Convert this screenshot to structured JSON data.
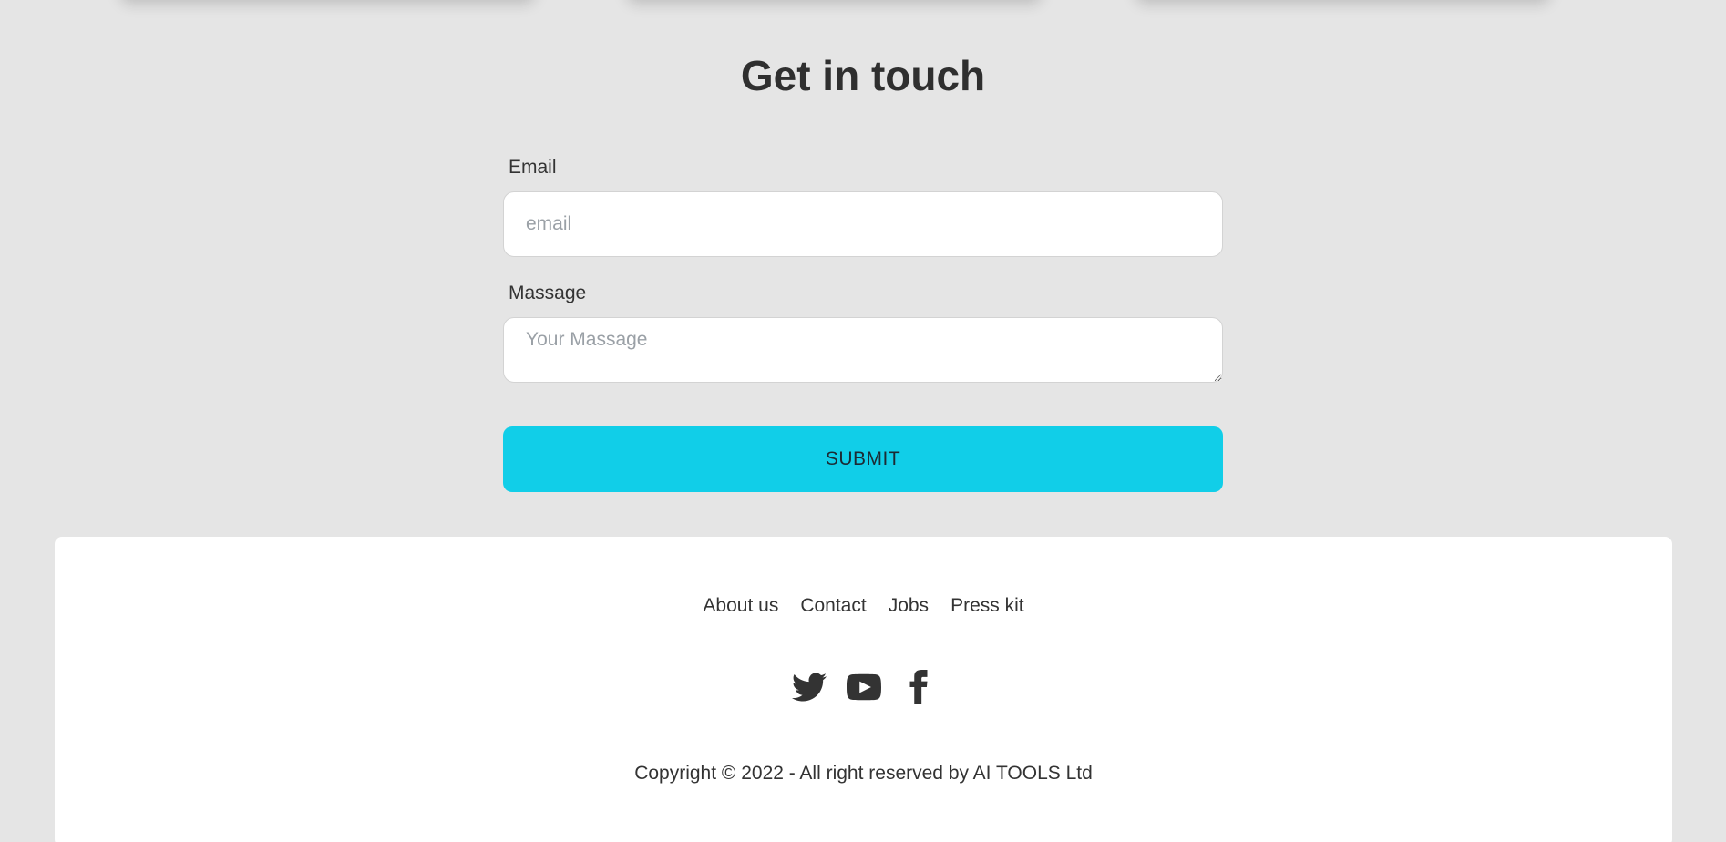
{
  "contact": {
    "title": "Get in touch",
    "email_label": "Email",
    "email_placeholder": "email",
    "message_label": "Massage",
    "message_placeholder": "Your Massage",
    "submit_label": "SUBMIT"
  },
  "footer": {
    "links": [
      "About us",
      "Contact",
      "Jobs",
      "Press kit"
    ],
    "social": [
      "twitter-icon",
      "youtube-icon",
      "facebook-icon"
    ],
    "copyright": "Copyright © 2022 - All right reserved by AI TOOLS Ltd"
  },
  "colors": {
    "background": "#e5e5e5",
    "accent": "#11cee8",
    "footer_bg": "#ffffff",
    "text": "#333333"
  }
}
